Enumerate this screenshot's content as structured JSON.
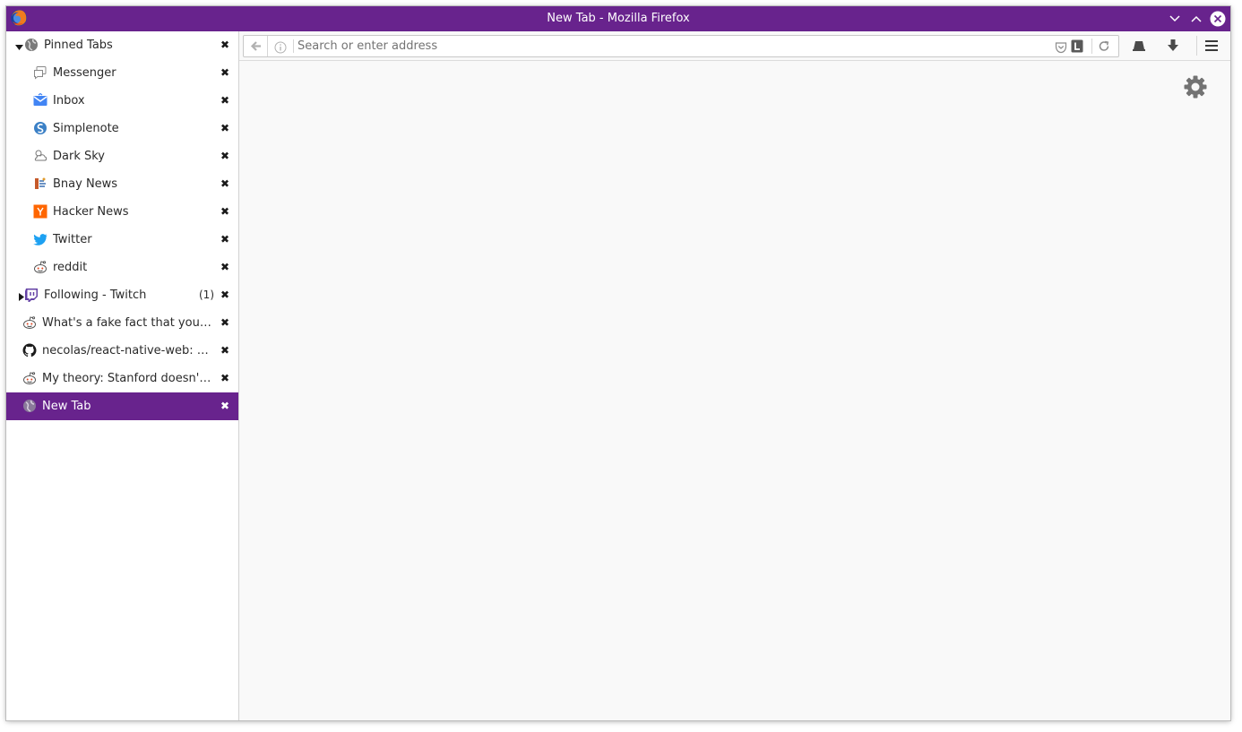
{
  "window": {
    "title": "New Tab - Mozilla Firefox",
    "accent_color": "#68238d",
    "controls": [
      "minimize-icon",
      "maximize-icon",
      "close-icon"
    ]
  },
  "sidebar": {
    "tabs": [
      {
        "label": "Pinned Tabs",
        "icon": "globe-icon",
        "twisty": "expanded",
        "close": "✖"
      },
      {
        "label": "Messenger",
        "icon": "messenger-icon",
        "close": "✖"
      },
      {
        "label": "Inbox",
        "icon": "inbox-icon",
        "close": "✖"
      },
      {
        "label": "Simplenote",
        "icon": "simplenote-icon",
        "close": "✖"
      },
      {
        "label": "Dark Sky",
        "icon": "darksky-icon",
        "close": "✖"
      },
      {
        "label": "Bnay News",
        "icon": "bnay-news-icon",
        "close": "✖"
      },
      {
        "label": "Hacker News",
        "icon": "hacker-news-icon",
        "close": "✖"
      },
      {
        "label": "Twitter",
        "icon": "twitter-icon",
        "close": "✖"
      },
      {
        "label": "reddit",
        "icon": "reddit-icon",
        "close": "✖"
      },
      {
        "label": "Following - Twitch",
        "icon": "twitch-icon",
        "twisty": "collapsed",
        "count": "(1)",
        "close": "✖"
      },
      {
        "label": "What's a fake fact that you b…",
        "icon": "reddit-icon",
        "close": "✖"
      },
      {
        "label": "necolas/react-native-web: R…",
        "icon": "github-icon",
        "close": "✖"
      },
      {
        "label": "My theory: Stanford doesn't …",
        "icon": "reddit-icon",
        "close": "✖"
      },
      {
        "label": "New Tab",
        "icon": "globe-icon",
        "active": true,
        "close": "✖"
      }
    ]
  },
  "toolbar": {
    "url_placeholder": "Search or enter address",
    "url_value": "",
    "icons": [
      "back-arrow-icon",
      "info-icon",
      "pocket-icon",
      "lastpass-icon",
      "reload-icon",
      "library-icon",
      "download-icon",
      "hamburger-menu-icon"
    ]
  },
  "content": {
    "icons": [
      "gear-icon"
    ]
  }
}
